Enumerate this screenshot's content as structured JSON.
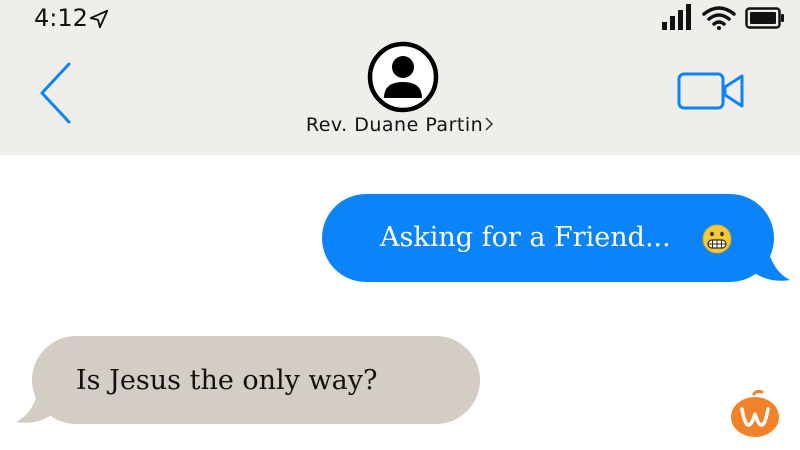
{
  "status_bar": {
    "time": "4:12",
    "icons": [
      "location-arrow-icon",
      "cellular-signal-icon",
      "wifi-icon",
      "battery-icon"
    ]
  },
  "header": {
    "back_icon": "chevron-left-icon",
    "contact_name": "Rev. Duane Partin",
    "contact_icon": "person-avatar-icon",
    "video_icon": "video-camera-icon"
  },
  "messages": [
    {
      "direction": "sent",
      "text": "Asking for a Friend...",
      "emoji": "grimacing-face-emoji"
    },
    {
      "direction": "received",
      "text": "Is Jesus the only way?"
    }
  ],
  "colors": {
    "header_bg": "#efeeeb",
    "accent_blue": "#0a84f8",
    "sent_bubble": "#0a84f8",
    "received_bubble": "#d3cdc4",
    "watermark": "#f2822a"
  },
  "watermark_icon": "orange-w-pumpkin-logo"
}
